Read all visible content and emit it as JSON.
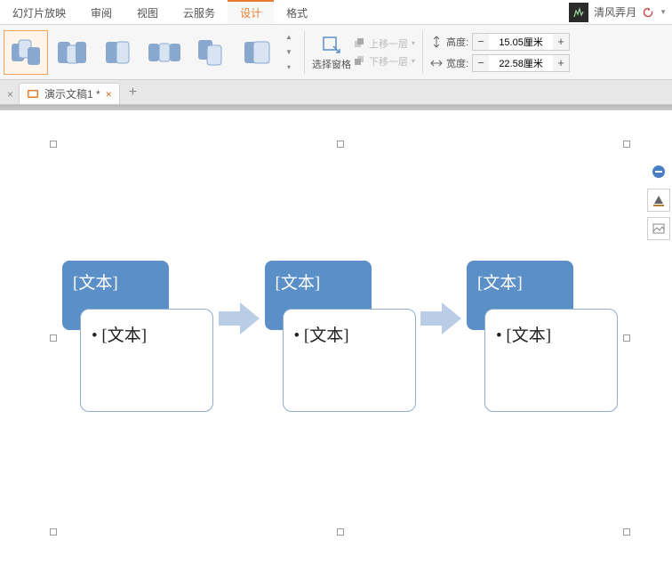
{
  "menu": {
    "tabs": [
      {
        "label": "幻灯片放映"
      },
      {
        "label": "审阅"
      },
      {
        "label": "视图"
      },
      {
        "label": "云服务"
      },
      {
        "label": "设计"
      },
      {
        "label": "格式"
      }
    ],
    "active_index": 4,
    "username": "清风弄月"
  },
  "ribbon": {
    "select_pane": "选择窗格",
    "move_up": "上移一层",
    "move_down": "下移一层",
    "height_label": "高度:",
    "height_value": "15.05厘米",
    "width_label": "宽度:",
    "width_value": "22.58厘米"
  },
  "doctab": {
    "title": "演示文稿1 *"
  },
  "smartart": {
    "nodes": [
      {
        "head": "[文本]",
        "body": "[文本]"
      },
      {
        "head": "[文本]",
        "body": "[文本]"
      },
      {
        "head": "[文本]",
        "body": "[文本]"
      }
    ]
  }
}
